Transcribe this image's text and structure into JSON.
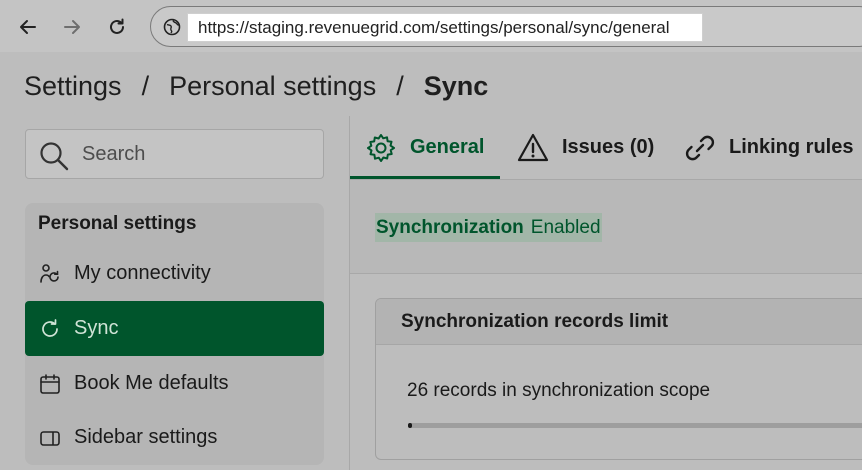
{
  "browser": {
    "url": "https://staging.revenuegrid.com/settings/personal/sync/general"
  },
  "breadcrumb": {
    "items": [
      "Settings",
      "Personal settings",
      "Sync"
    ],
    "separator": "/"
  },
  "sidebar": {
    "search_placeholder": "Search",
    "section_title": "Personal settings",
    "items": [
      {
        "label": "My connectivity",
        "icon": "connectivity-icon"
      },
      {
        "label": "Sync",
        "icon": "sync-icon",
        "active": true
      },
      {
        "label": "Book Me defaults",
        "icon": "calendar-icon"
      },
      {
        "label": "Sidebar settings",
        "icon": "sidebar-panel-icon"
      }
    ]
  },
  "tabs": [
    {
      "label": "General",
      "icon": "gear-icon",
      "active": true
    },
    {
      "label": "Issues (0)",
      "icon": "warning-triangle-icon"
    },
    {
      "label": "Linking rules",
      "icon": "link-icon"
    }
  ],
  "status": {
    "label": "Synchronization",
    "value": "Enabled"
  },
  "records_card": {
    "title": "Synchronization records limit",
    "text": "26 records in synchronization scope",
    "progress_fraction": 0.005
  },
  "colors": {
    "brand_green": "#00552c",
    "active_item_text": "#cfe3d6"
  }
}
